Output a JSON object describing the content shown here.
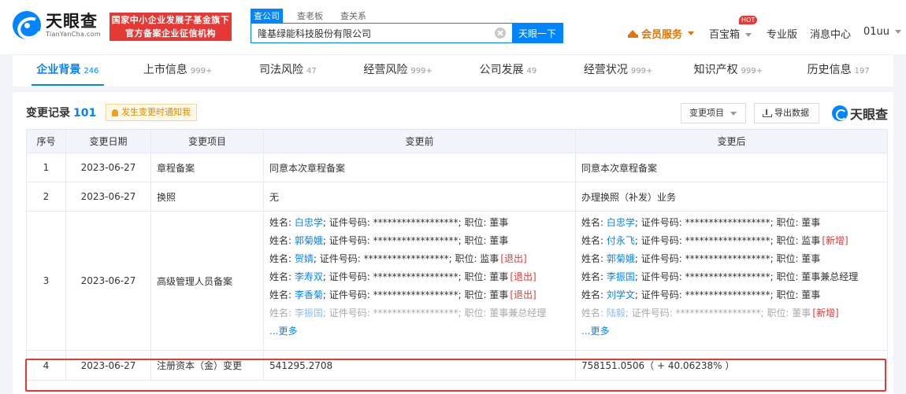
{
  "header": {
    "logo_cn": "天眼查",
    "logo_en": "TianYanCha.com",
    "banner_line1": "国家中小企业发展子基金旗下",
    "banner_line2": "官方备案企业征信机构",
    "search_tabs": [
      "查公司",
      "查老板",
      "查关系"
    ],
    "search_value": "隆基绿能科技股份有限公司",
    "search_button": "天眼一下",
    "vip_label": "会员服务",
    "treasure_label": "百宝箱",
    "hot_badge": "HOT",
    "pro_label": "专业版",
    "msg_label": "消息中心",
    "user_label": "01uu"
  },
  "tabs": [
    {
      "label": "企业背景",
      "count": "246"
    },
    {
      "label": "上市信息",
      "count": "999+"
    },
    {
      "label": "司法风险",
      "count": "47"
    },
    {
      "label": "经营风险",
      "count": "999+"
    },
    {
      "label": "公司发展",
      "count": "49"
    },
    {
      "label": "经营状况",
      "count": "999+"
    },
    {
      "label": "知识产权",
      "count": "999+"
    },
    {
      "label": "历史信息",
      "count": "197"
    }
  ],
  "section": {
    "title": "变更记录",
    "count": "101",
    "notify_label": "发生变更时通知我",
    "filter_label": "变更项目",
    "export_label": "导出数据",
    "watermark": "天眼查"
  },
  "table": {
    "headers": [
      "序号",
      "变更日期",
      "变更项目",
      "变更前",
      "变更后"
    ],
    "rows": [
      {
        "no": "1",
        "date": "2023-06-27",
        "item": "章程备案",
        "before": "同意本次章程备案",
        "after": "同意本次章程备案"
      },
      {
        "no": "2",
        "date": "2023-06-27",
        "item": "换照",
        "before": "无",
        "after": "办理换照（补发）业务"
      },
      {
        "no": "3",
        "date": "2023-06-27",
        "item": "高级管理人员备案",
        "before": [
          {
            "name": "白忠学",
            "mid": "; 证件号码: ******************; 职位: 董事",
            "tag": ""
          },
          {
            "name": "郭菊娥",
            "mid": "; 证件号码: ******************; 职位: 董事",
            "tag": ""
          },
          {
            "name": "贺婧",
            "mid": "; 证件号码: ******************; 职位: 监事",
            "tag": "[退出]"
          },
          {
            "name": "李寿双",
            "mid": "; 证件号码: ******************; 职位: 董事",
            "tag": "[退出]"
          },
          {
            "name": "李香菊",
            "mid": "; 证件号码: ******************; 职位: 董事",
            "tag": "[退出]"
          },
          {
            "name": "李振国",
            "mid": "; 证件号码: ******************; 职位: 董事兼总经理",
            "tag": ""
          }
        ],
        "after": [
          {
            "name": "白忠学",
            "mid": "; 证件号码: ******************; 职位: 董事",
            "tag": ""
          },
          {
            "name": "付永飞",
            "mid": "; 证件号码: ******************; 职位: 监事",
            "tag": "[新增]"
          },
          {
            "name": "郭菊娥",
            "mid": "; 证件号码: ******************; 职位: 董事",
            "tag": ""
          },
          {
            "name": "李振国",
            "mid": "; 证件号码: ******************; 职位: 董事兼总经理",
            "tag": ""
          },
          {
            "name": "刘学文",
            "mid": "; 证件号码: ******************; 职位: 董事",
            "tag": ""
          },
          {
            "name": "陆毅",
            "mid": "; 证件号码: ******************; 职位: 董事",
            "tag": "[新增]"
          }
        ],
        "more": "...更多"
      },
      {
        "no": "4",
        "date": "2023-06-27",
        "item": "注册资本（金）变更",
        "before": "541295.2708",
        "after": "758151.0506（ + 40.06238% ）"
      }
    ],
    "name_prefix": "姓名: "
  }
}
